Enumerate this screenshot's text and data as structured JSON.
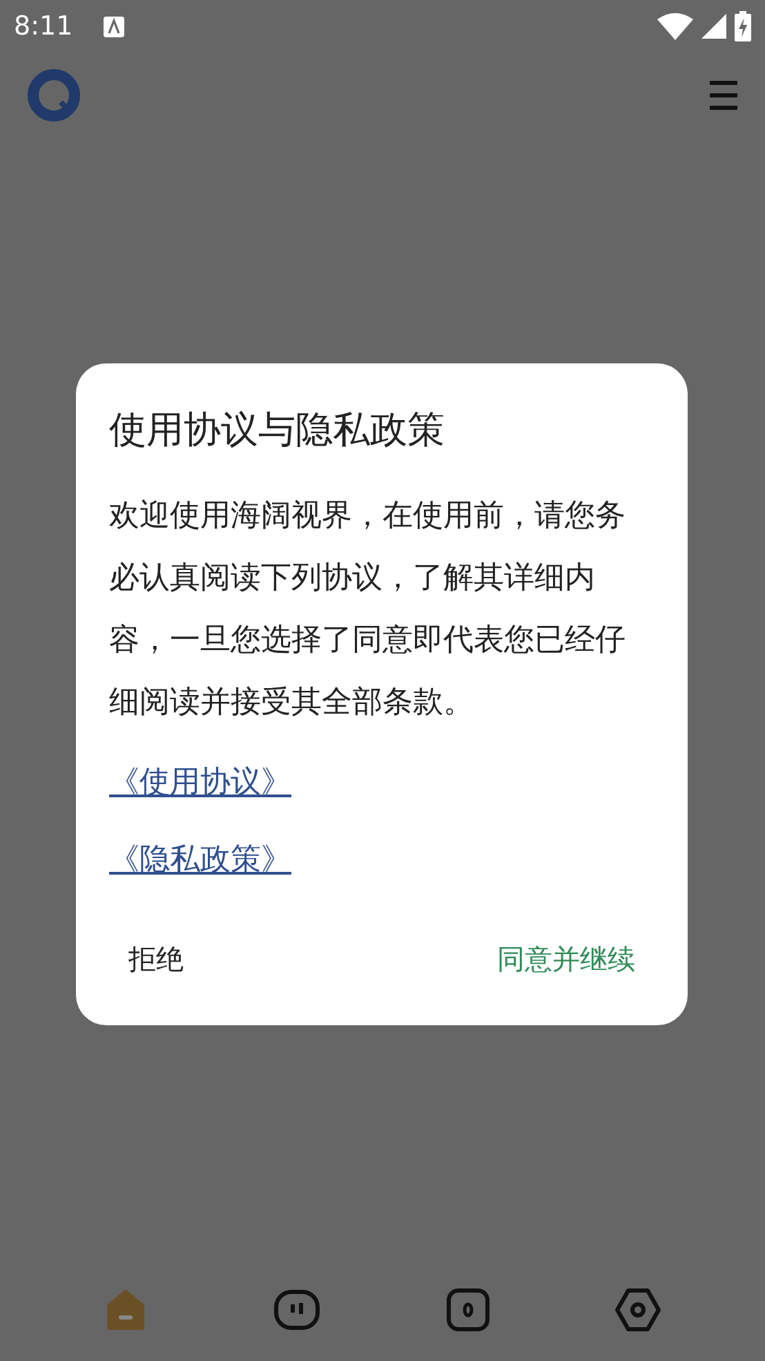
{
  "status_bar": {
    "time": "8:11"
  },
  "dialog": {
    "title": "使用协议与隐私政策",
    "message": "欢迎使用海阔视界，在使用前，请您务必认真阅读下列协议，了解其详细内容，一旦您选择了同意即代表您已经仔细阅读并接受其全部条款。",
    "links": [
      "《使用协议》",
      "《隐私政策》"
    ],
    "buttons": [
      {
        "label": "拒绝",
        "kind": "neutral"
      },
      {
        "label": "同意并继续",
        "kind": "positive"
      }
    ]
  },
  "bottom_nav": [
    {
      "kind": "home",
      "selected": true
    },
    {
      "kind": "face",
      "selected": false
    },
    {
      "kind": "counter",
      "selected": false
    },
    {
      "kind": "settings",
      "selected": false
    }
  ]
}
